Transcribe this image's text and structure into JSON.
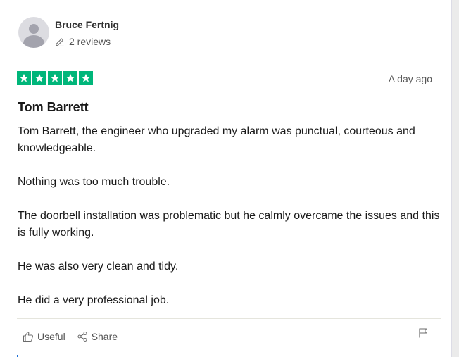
{
  "reviewer": {
    "name": "Bruce Fertnig",
    "reviews_count": "2 reviews"
  },
  "review": {
    "rating": 5,
    "rating_max": 5,
    "star_color": "#00b67a",
    "date": "A day ago",
    "title": "Tom Barrett",
    "paragraphs": [
      "Tom Barrett, the engineer who upgraded my alarm was punctual, courteous and knowledgeable.",
      "Nothing was too much trouble.",
      "The doorbell installation was problematic but he calmly overcame the issues and this is fully working.",
      "He was also very clean and tidy.",
      "He did a very professional job."
    ]
  },
  "actions": {
    "useful_label": "Useful",
    "share_label": "Share"
  },
  "icons": {
    "avatar": "user-avatar-placeholder",
    "reviews": "pencil-icon",
    "useful": "thumbs-up-icon",
    "share": "share-icon",
    "report": "flag-icon"
  }
}
